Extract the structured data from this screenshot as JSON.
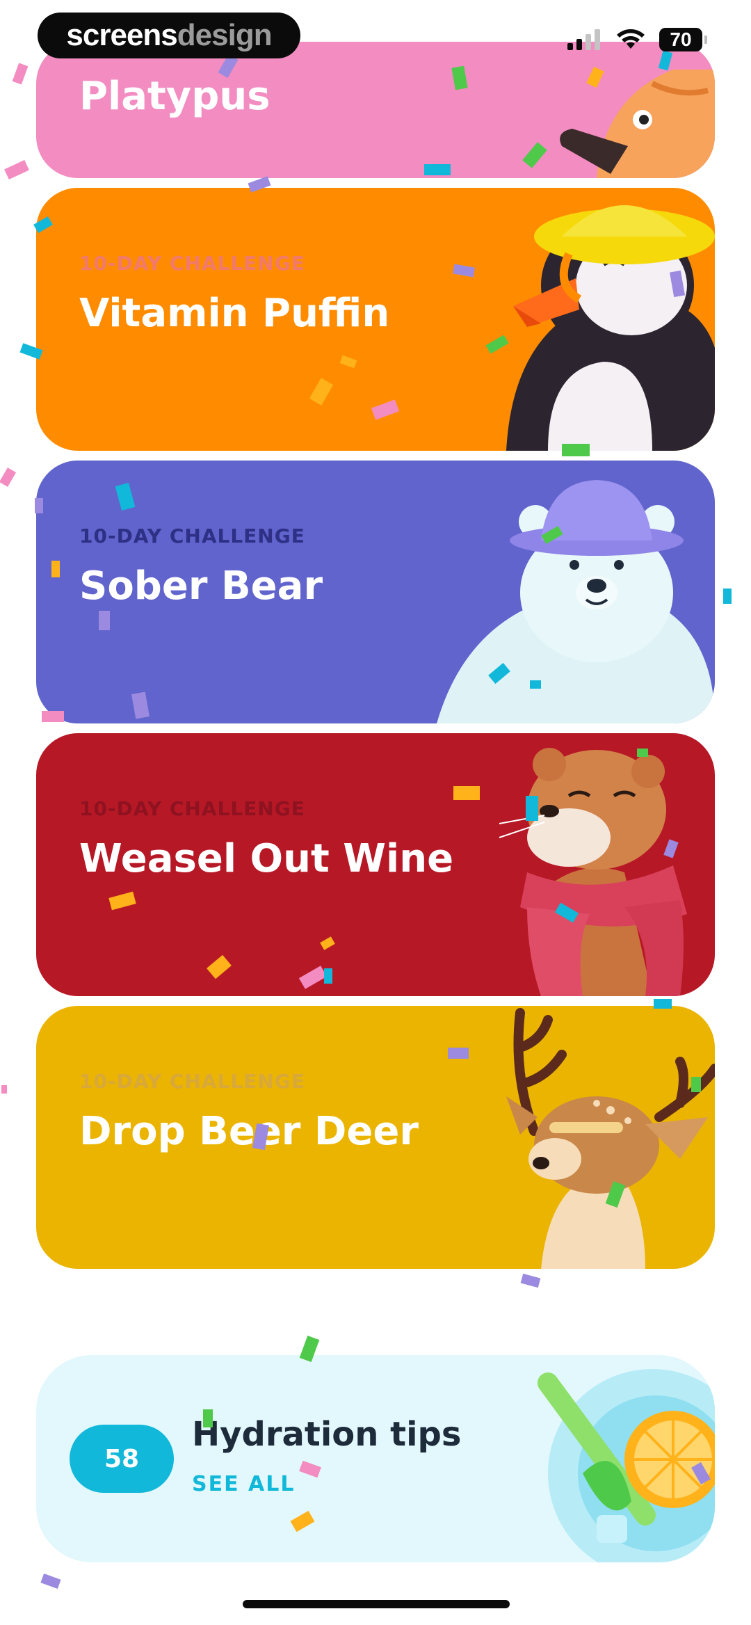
{
  "status_bar": {
    "brand_part1": "screens",
    "brand_part2": "design",
    "battery": "70"
  },
  "cards": [
    {
      "eyebrow": "",
      "title": "Platypus",
      "color": "#f28cc1",
      "eyebrow_color": ""
    },
    {
      "eyebrow": "10-DAY CHALLENGE",
      "title": "Vitamin Puffin",
      "color": "#ff8c00",
      "eyebrow_color": "#f27a6b"
    },
    {
      "eyebrow": "10-DAY CHALLENGE",
      "title": "Sober Bear",
      "color": "#6064cc",
      "eyebrow_color": "#2e3085"
    },
    {
      "eyebrow": "10-DAY CHALLENGE",
      "title": "Weasel Out Wine",
      "color": "#b71826",
      "eyebrow_color": "#8e1220"
    },
    {
      "eyebrow": "10-DAY CHALLENGE",
      "title": "Drop Beer Deer",
      "color": "#eab400",
      "eyebrow_color": "#d8a83a"
    }
  ],
  "hydration": {
    "count": "58",
    "title": "Hydration tips",
    "link": "SEE ALL",
    "accent": "#11b8d9"
  },
  "icons": [
    "signal-icon",
    "wifi-icon",
    "battery-icon",
    "platypus-illustration",
    "puffin-illustration",
    "bear-illustration",
    "weasel-illustration",
    "deer-illustration",
    "drink-illustration"
  ]
}
